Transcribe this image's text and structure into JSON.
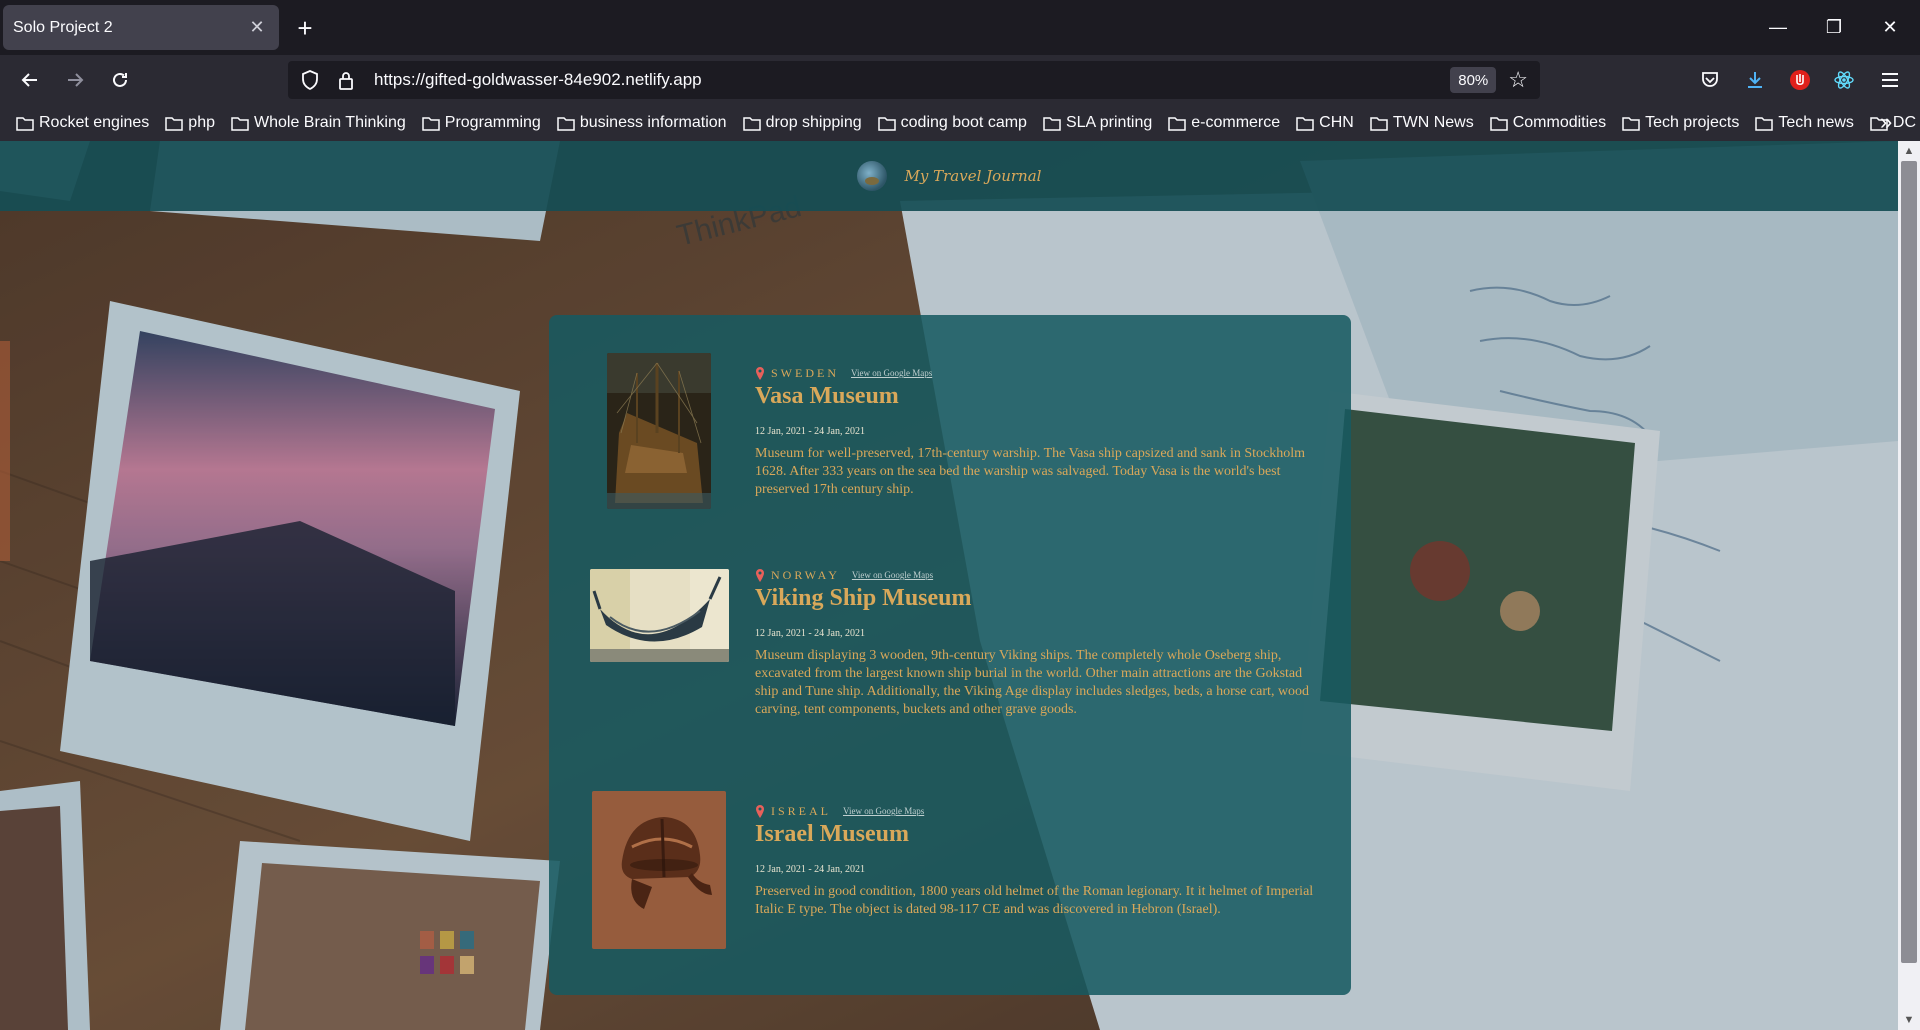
{
  "browser": {
    "tab": {
      "title": "Solo Project 2",
      "close_glyph": "✕"
    },
    "new_tab_glyph": "+",
    "window_controls": {
      "minimize": "—",
      "restore": "❐",
      "close": "✕"
    },
    "address": {
      "url": "https://gifted-goldwasser-84e902.netlify.app",
      "zoom": "80%"
    },
    "bookmarks": [
      "Rocket engines",
      "php",
      "Whole Brain Thinking",
      "Programming",
      "business information",
      "drop shipping",
      "coding boot camp",
      "SLA printing",
      "e-commerce",
      "CHN",
      "TWN News",
      "Commodities",
      "Tech projects",
      "Tech news",
      "DC trip"
    ],
    "bookmarks_overflow": "»"
  },
  "site": {
    "title": "My Travel Journal",
    "colors": {
      "header_bg": "#164e54",
      "card_bg": "#175a60",
      "accent": "#d9a85a",
      "pin": "#e8605a"
    }
  },
  "entries": [
    {
      "country": "SWEDEN",
      "maps_link": "View on Google Maps",
      "title": "Vasa Museum",
      "dates": "12 Jan, 2021 - 24 Jan, 2021",
      "description": "Museum for well-preserved, 17th-century warship. The Vasa ship capsized and sank in Stockholm 1628. After 333 years on the sea bed the warship was salvaged. Today Vasa is the world's best preserved 17th century ship."
    },
    {
      "country": "NORWAY",
      "maps_link": "View on Google Maps",
      "title": "Viking Ship Museum",
      "dates": "12 Jan, 2021 - 24 Jan, 2021",
      "description": "Museum displaying 3 wooden, 9th-century Viking ships. The completely whole Oseberg ship, excavated from the largest known ship burial in the world. Other main attractions are the Gokstad ship and Tune ship. Additionally, the Viking Age display includes sledges, beds, a horse cart, wood carving, tent components, buckets and other grave goods."
    },
    {
      "country": "ISREAL",
      "maps_link": "View on Google Maps",
      "title": "Israel Museum",
      "dates": "12 Jan, 2021 - 24 Jan, 2021",
      "description": "Preserved in good condition, 1800 years old helmet of the Roman legionary. It it helmet of Imperial Italic E type. The object is dated 98-117 CE and was discovered in Hebron (Israel)."
    }
  ]
}
